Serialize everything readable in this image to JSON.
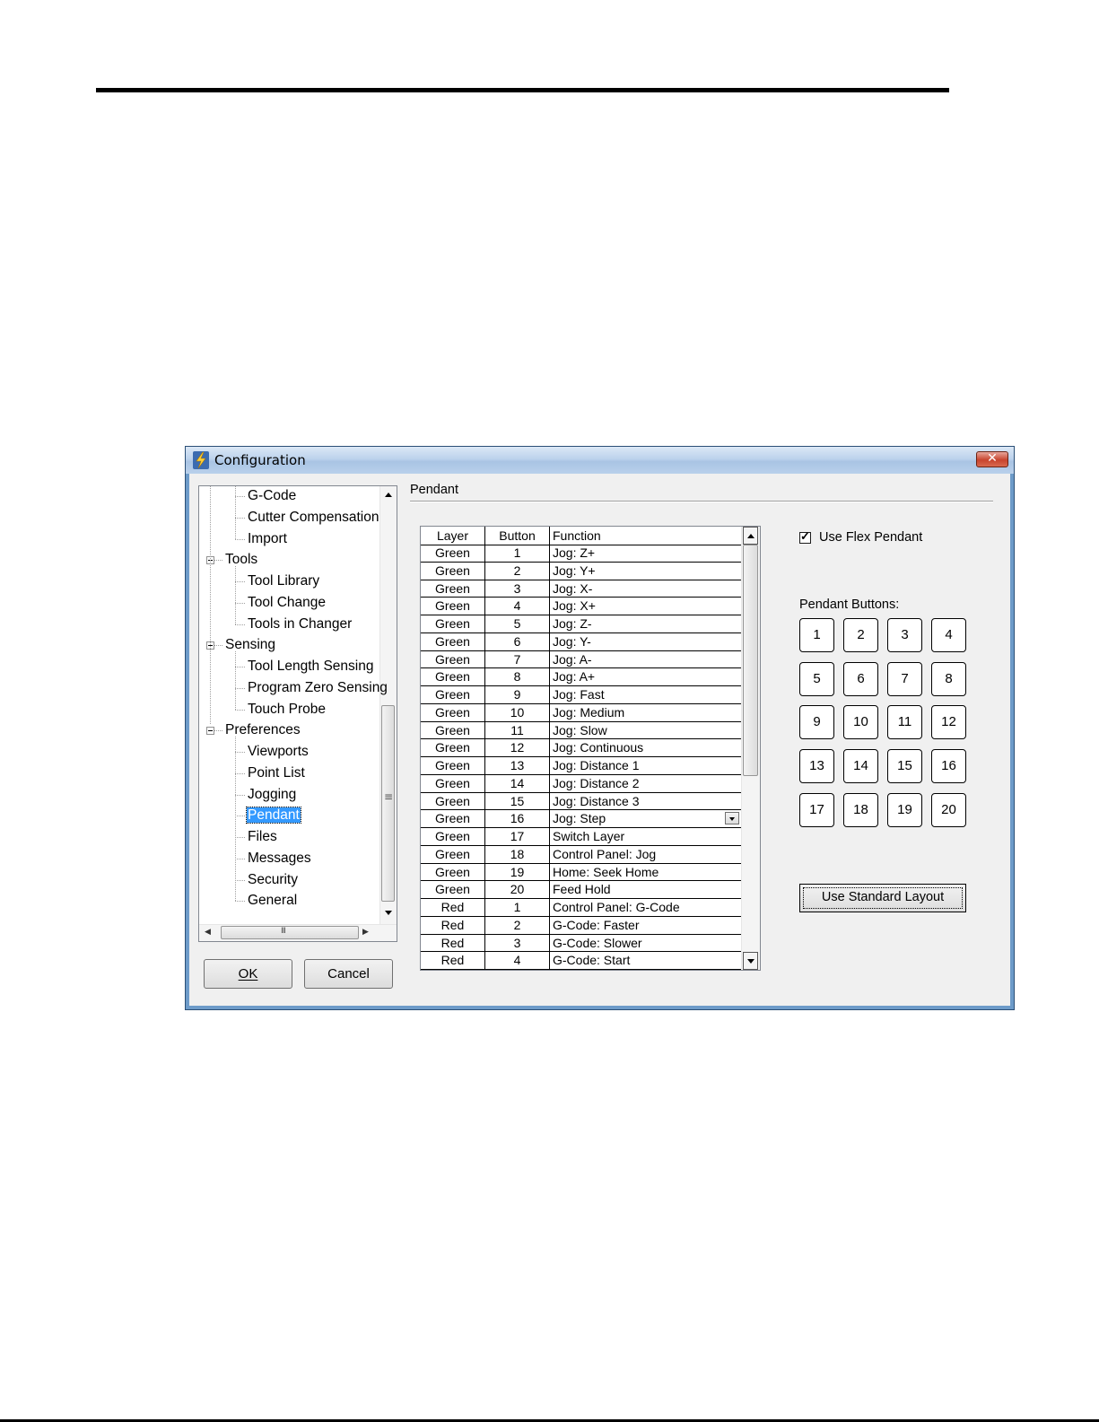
{
  "window": {
    "title": "Configuration",
    "app_icon": "lightning-bolt-icon",
    "close_icon": "close-icon"
  },
  "tree": {
    "items": [
      {
        "label": "G-Code",
        "level": 2
      },
      {
        "label": "Cutter Compensation",
        "level": 2
      },
      {
        "label": "Import",
        "level": 2
      },
      {
        "label": "Tools",
        "level": 1,
        "expanded": true
      },
      {
        "label": "Tool Library",
        "level": 2
      },
      {
        "label": "Tool Change",
        "level": 2
      },
      {
        "label": "Tools in Changer",
        "level": 2
      },
      {
        "label": "Sensing",
        "level": 1,
        "expanded": true
      },
      {
        "label": "Tool Length Sensing",
        "level": 2
      },
      {
        "label": "Program Zero Sensing",
        "level": 2
      },
      {
        "label": "Touch Probe",
        "level": 2
      },
      {
        "label": "Preferences",
        "level": 1,
        "expanded": true
      },
      {
        "label": "Viewports",
        "level": 2
      },
      {
        "label": "Point List",
        "level": 2
      },
      {
        "label": "Jogging",
        "level": 2
      },
      {
        "label": "Pendant",
        "level": 2,
        "selected": true
      },
      {
        "label": "Files",
        "level": 2
      },
      {
        "label": "Messages",
        "level": 2
      },
      {
        "label": "Security",
        "level": 2
      },
      {
        "label": "General",
        "level": 2
      }
    ]
  },
  "buttons": {
    "ok": "OK",
    "cancel": "Cancel"
  },
  "panel": {
    "title": "Pendant",
    "use_flex_pendant_label": "Use Flex Pendant",
    "use_flex_pendant_checked": true,
    "pendant_buttons_label": "Pendant Buttons:",
    "pendant_buttons": [
      "1",
      "2",
      "3",
      "4",
      "5",
      "6",
      "7",
      "8",
      "9",
      "10",
      "11",
      "12",
      "13",
      "14",
      "15",
      "16",
      "17",
      "18",
      "19",
      "20"
    ],
    "use_standard_layout_label": "Use Standard Layout"
  },
  "grid": {
    "columns": [
      "Layer",
      "Button",
      "Function"
    ],
    "rows": [
      [
        "Green",
        "1",
        "Jog: Z+"
      ],
      [
        "Green",
        "2",
        "Jog: Y+"
      ],
      [
        "Green",
        "3",
        "Jog: X-"
      ],
      [
        "Green",
        "4",
        "Jog: X+"
      ],
      [
        "Green",
        "5",
        "Jog: Z-"
      ],
      [
        "Green",
        "6",
        "Jog: Y-"
      ],
      [
        "Green",
        "7",
        "Jog: A-"
      ],
      [
        "Green",
        "8",
        "Jog: A+"
      ],
      [
        "Green",
        "9",
        "Jog: Fast"
      ],
      [
        "Green",
        "10",
        "Jog: Medium"
      ],
      [
        "Green",
        "11",
        "Jog: Slow"
      ],
      [
        "Green",
        "12",
        "Jog: Continuous"
      ],
      [
        "Green",
        "13",
        "Jog: Distance 1"
      ],
      [
        "Green",
        "14",
        "Jog: Distance 2"
      ],
      [
        "Green",
        "15",
        "Jog: Distance 3"
      ],
      [
        "Green",
        "16",
        "Jog: Step"
      ],
      [
        "Green",
        "17",
        "Switch Layer"
      ],
      [
        "Green",
        "18",
        "Control Panel: Jog"
      ],
      [
        "Green",
        "19",
        "Home: Seek Home"
      ],
      [
        "Green",
        "20",
        "Feed Hold"
      ],
      [
        "Red",
        "1",
        "Control Panel: G-Code"
      ],
      [
        "Red",
        "2",
        "G-Code: Faster"
      ],
      [
        "Red",
        "3",
        "G-Code: Slower"
      ],
      [
        "Red",
        "4",
        "G-Code: Start"
      ]
    ],
    "combo_row_index": 15
  }
}
